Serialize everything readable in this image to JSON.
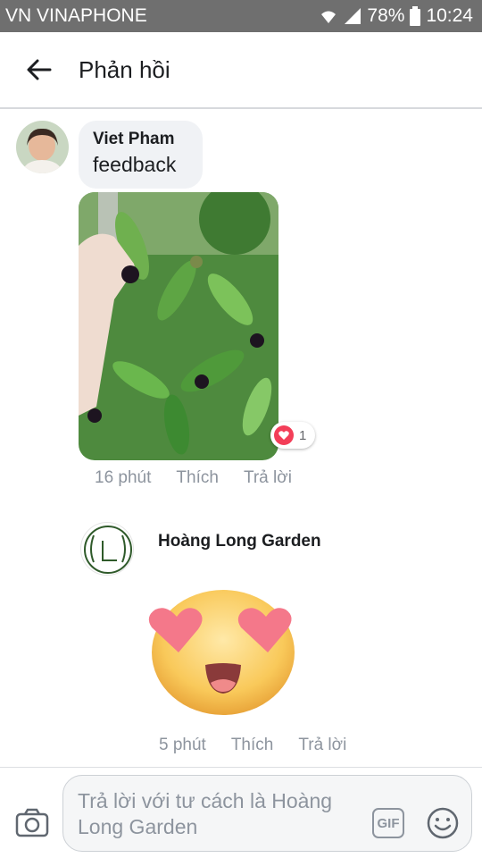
{
  "status_bar": {
    "carrier": "VN VINAPHONE",
    "battery": "78%",
    "time": "10:24"
  },
  "header": {
    "title": "Phản hồi"
  },
  "comments": [
    {
      "author": "Viet Pham",
      "text": "feedback",
      "reaction_count": "1",
      "time": "16 phút",
      "like_label": "Thích",
      "reply_label": "Trả lời"
    },
    {
      "author": "Hoàng Long Garden",
      "time": "5 phút",
      "like_label": "Thích",
      "reply_label": "Trả lời"
    }
  ],
  "composer": {
    "placeholder": "Trả lời với tư cách là Hoàng Long Garden",
    "gif_label": "GIF"
  },
  "colors": {
    "status_bar": "#6f6f6f",
    "bubble": "#f0f2f5",
    "meta_text": "#8d949e",
    "love_reaction": "#f33e58"
  }
}
